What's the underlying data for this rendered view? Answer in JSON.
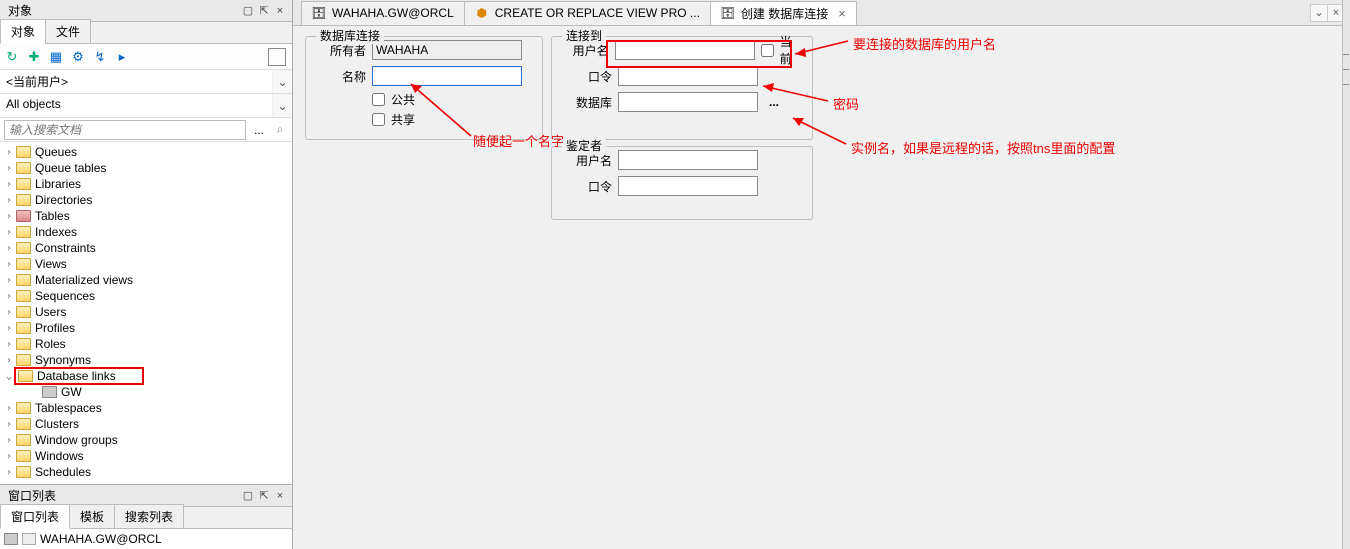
{
  "sidebar": {
    "title": "对象",
    "tabs": {
      "objects": "对象",
      "files": "文件"
    },
    "toolbar_icons": [
      "refresh",
      "add",
      "open",
      "prop",
      "link",
      "run"
    ],
    "user_dropdown": "<当前用户>",
    "objects_dropdown": "All objects",
    "search_placeholder": "输入搜索文档",
    "tree": [
      {
        "label": "Queues"
      },
      {
        "label": "Queue tables"
      },
      {
        "label": "Libraries"
      },
      {
        "label": "Directories"
      },
      {
        "label": "Tables",
        "dark": true
      },
      {
        "label": "Indexes"
      },
      {
        "label": "Constraints"
      },
      {
        "label": "Views"
      },
      {
        "label": "Materialized views"
      },
      {
        "label": "Sequences"
      },
      {
        "label": "Users"
      },
      {
        "label": "Profiles"
      },
      {
        "label": "Roles"
      },
      {
        "label": "Synonyms"
      },
      {
        "label": "Database links",
        "expanded": true,
        "highlight": true
      },
      {
        "label": "GW",
        "child": true,
        "dblink": true
      },
      {
        "label": "Tablespaces"
      },
      {
        "label": "Clusters"
      },
      {
        "label": "Window groups"
      },
      {
        "label": "Windows"
      },
      {
        "label": "Schedules"
      }
    ]
  },
  "bottom_panel": {
    "title": "窗口列表",
    "tabs": {
      "winlist": "窗口列表",
      "templates": "模板",
      "searchlist": "搜索列表"
    },
    "item": "WAHAHA.GW@ORCL"
  },
  "main_tabs": [
    {
      "label": "WAHAHA.GW@ORCL",
      "icon": "db"
    },
    {
      "label": "CREATE OR REPLACE VIEW PRO ...",
      "icon": "script"
    },
    {
      "label": "创建 数据库连接",
      "icon": "db",
      "active": true,
      "closable": true
    }
  ],
  "form": {
    "fs1_legend": "数据库连接",
    "owner_label": "所有者",
    "owner_value": "WAHAHA",
    "name_label": "名称",
    "name_value": "",
    "public_label": "公共",
    "share_label": "共享",
    "fs2_legend": "连接到",
    "user_label": "用户名",
    "user_value": "",
    "current_label": "当前",
    "pwd_label": "口令",
    "pwd_value": "",
    "db_label": "数据库",
    "db_value": "",
    "fs3_legend": "鉴定者",
    "auth_user_label": "用户名",
    "auth_user_value": "",
    "auth_pwd_label": "口令",
    "auth_pwd_value": ""
  },
  "annotations": {
    "a1": "要连接的数据库的用户名",
    "a2": "密码",
    "a3": "实例名，如果是远程的话，按照tns里面的配置",
    "a4": "随便起一个名字"
  }
}
